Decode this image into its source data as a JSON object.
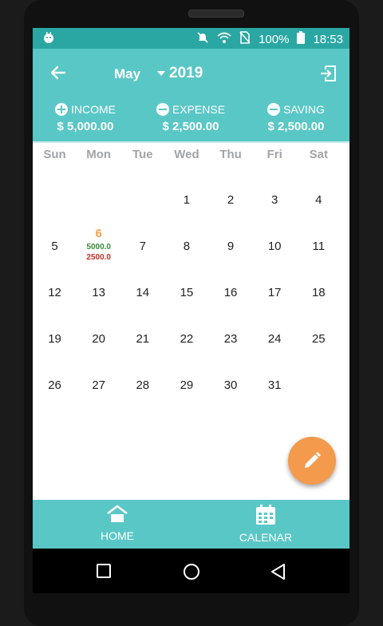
{
  "status_bar": {
    "battery": "100%",
    "time": "18:53"
  },
  "header": {
    "month": "May",
    "year": "2019",
    "summary": [
      {
        "label": "INCOME",
        "value": "$ 5,000.00",
        "icon": "plus-circle-icon"
      },
      {
        "label": "EXPENSE",
        "value": "$ 2,500.00",
        "icon": "minus-circle-icon"
      },
      {
        "label": "SAVING",
        "value": "$ 2,500.00",
        "icon": "minus-circle-icon"
      }
    ]
  },
  "weekdays": [
    "Sun",
    "Mon",
    "Tue",
    "Wed",
    "Thu",
    "Fri",
    "Sat"
  ],
  "calendar": {
    "weeks": [
      [
        null,
        null,
        null,
        "1",
        "2",
        "3",
        "4"
      ],
      [
        "5",
        "6",
        "7",
        "8",
        "9",
        "10",
        "11"
      ],
      [
        "12",
        "13",
        "14",
        "15",
        "16",
        "17",
        "18"
      ],
      [
        "19",
        "20",
        "21",
        "22",
        "23",
        "24",
        "25"
      ],
      [
        "26",
        "27",
        "28",
        "29",
        "30",
        "31",
        null
      ]
    ],
    "today": "6",
    "entries": {
      "6": {
        "income": "5000.0",
        "expense": "2500.0"
      }
    }
  },
  "bottom_nav": {
    "home_label": "HOME",
    "calendar_label": "CALENAR"
  },
  "colors": {
    "primary": "#59c7c5",
    "status_bar": "#2aa7a2",
    "fab": "#f39a4d",
    "today": "#f0a04b",
    "income": "#3a8a3a",
    "expense": "#c0302a"
  }
}
